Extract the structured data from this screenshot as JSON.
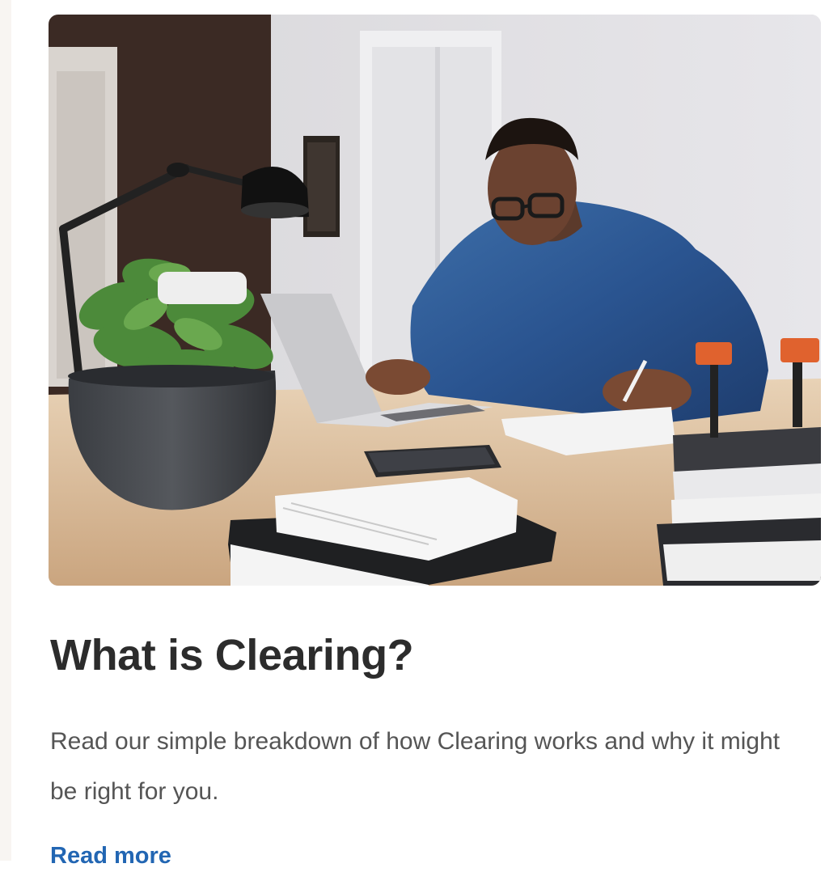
{
  "card": {
    "image_icon": "photo-student-studying-at-desk",
    "title": "What is Clearing?",
    "description": "Read our simple breakdown of how Clearing works and why it might be right for you.",
    "link_label": "Read more"
  },
  "colors": {
    "title": "#2c2c2c",
    "body_text": "#555555",
    "link": "#2266b3",
    "background": "#ffffff"
  }
}
